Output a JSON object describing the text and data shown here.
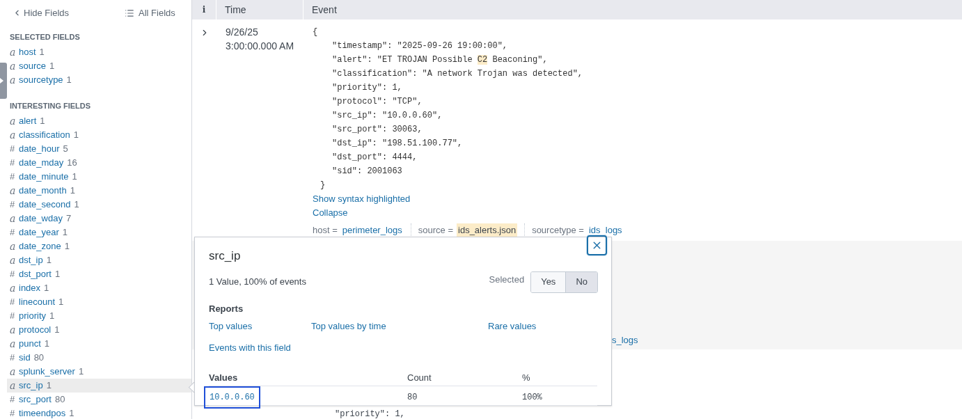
{
  "sidebar": {
    "hide_button": "Hide Fields",
    "all_fields_button": "All Fields",
    "groups": [
      {
        "title": "SELECTED FIELDS",
        "items": [
          {
            "kind": "string",
            "glyph": "a",
            "name": "host",
            "count": "1",
            "selected": false
          },
          {
            "kind": "string",
            "glyph": "a",
            "name": "source",
            "count": "1",
            "selected": false
          },
          {
            "kind": "string",
            "glyph": "a",
            "name": "sourcetype",
            "count": "1",
            "selected": false
          }
        ]
      },
      {
        "title": "INTERESTING FIELDS",
        "items": [
          {
            "kind": "string",
            "glyph": "a",
            "name": "alert",
            "count": "1",
            "selected": false
          },
          {
            "kind": "string",
            "glyph": "a",
            "name": "classification",
            "count": "1",
            "selected": false
          },
          {
            "kind": "number",
            "glyph": "#",
            "name": "date_hour",
            "count": "5",
            "selected": false
          },
          {
            "kind": "number",
            "glyph": "#",
            "name": "date_mday",
            "count": "16",
            "selected": false
          },
          {
            "kind": "number",
            "glyph": "#",
            "name": "date_minute",
            "count": "1",
            "selected": false
          },
          {
            "kind": "string",
            "glyph": "a",
            "name": "date_month",
            "count": "1",
            "selected": false
          },
          {
            "kind": "number",
            "glyph": "#",
            "name": "date_second",
            "count": "1",
            "selected": false
          },
          {
            "kind": "string",
            "glyph": "a",
            "name": "date_wday",
            "count": "7",
            "selected": false
          },
          {
            "kind": "number",
            "glyph": "#",
            "name": "date_year",
            "count": "1",
            "selected": false
          },
          {
            "kind": "string",
            "glyph": "a",
            "name": "date_zone",
            "count": "1",
            "selected": false
          },
          {
            "kind": "string",
            "glyph": "a",
            "name": "dst_ip",
            "count": "1",
            "selected": false
          },
          {
            "kind": "number",
            "glyph": "#",
            "name": "dst_port",
            "count": "1",
            "selected": false
          },
          {
            "kind": "string",
            "glyph": "a",
            "name": "index",
            "count": "1",
            "selected": false
          },
          {
            "kind": "number",
            "glyph": "#",
            "name": "linecount",
            "count": "1",
            "selected": false
          },
          {
            "kind": "number",
            "glyph": "#",
            "name": "priority",
            "count": "1",
            "selected": false
          },
          {
            "kind": "string",
            "glyph": "a",
            "name": "protocol",
            "count": "1",
            "selected": false
          },
          {
            "kind": "string",
            "glyph": "a",
            "name": "punct",
            "count": "1",
            "selected": false
          },
          {
            "kind": "number",
            "glyph": "#",
            "name": "sid",
            "count": "80",
            "selected": false
          },
          {
            "kind": "string",
            "glyph": "a",
            "name": "splunk_server",
            "count": "1",
            "selected": false
          },
          {
            "kind": "string",
            "glyph": "a",
            "name": "src_ip",
            "count": "1",
            "selected": true
          },
          {
            "kind": "number",
            "glyph": "#",
            "name": "src_port",
            "count": "80",
            "selected": false
          },
          {
            "kind": "number",
            "glyph": "#",
            "name": "timeendpos",
            "count": "1",
            "selected": false
          }
        ]
      }
    ]
  },
  "table": {
    "columns": [
      "i",
      "Time",
      "Event"
    ],
    "events": [
      {
        "date": "9/26/25",
        "time": "3:00:00.000 AM",
        "json": {
          "open": "{",
          "close": "}",
          "lines": [
            [
              {
                "text": "\"timestamp\": \"2025-09-26 19:00:00\",",
                "highlight": false
              }
            ],
            [
              {
                "text": "\"alert\": \"ET TROJAN Possible ",
                "highlight": false
              },
              {
                "text": "C2",
                "highlight": true
              },
              {
                "text": " Beaconing\",",
                "highlight": false
              }
            ],
            [
              {
                "text": "\"classification\": \"A network Trojan was detected\",",
                "highlight": false
              }
            ],
            [
              {
                "text": "\"priority\": 1,",
                "highlight": false
              }
            ],
            [
              {
                "text": "\"protocol\": \"TCP\",",
                "highlight": false
              }
            ],
            [
              {
                "text": "\"src_ip\": \"10.0.0.60\",",
                "highlight": false
              }
            ],
            [
              {
                "text": "\"src_port\": 30063,",
                "highlight": false
              }
            ],
            [
              {
                "text": "\"dst_ip\": \"198.51.100.77\",",
                "highlight": false
              }
            ],
            [
              {
                "text": "\"dst_port\": 4444,",
                "highlight": false
              }
            ],
            [
              {
                "text": "\"sid\": 2001063",
                "highlight": false
              }
            ]
          ]
        },
        "links": [
          "Show syntax highlighted",
          "Collapse"
        ],
        "fields": [
          {
            "key": "host =",
            "value": "perimeter_logs",
            "highlight": false
          },
          {
            "key": "source =",
            "value": "ids_alerts.json",
            "highlight": true
          },
          {
            "key": "sourcetype =",
            "value": "ids_logs",
            "highlight": false
          }
        ]
      }
    ],
    "partial_field_value": "s_logs",
    "partial_json_line": "\"priority\": 1,"
  },
  "popover": {
    "title": "src_ip",
    "summary": "1 Value, 100% of events",
    "selected_label": "Selected",
    "toggle": [
      {
        "label": "Yes",
        "selected": false
      },
      {
        "label": "No",
        "selected": true
      }
    ],
    "reports_title": "Reports",
    "reports": [
      "Top values",
      "Top values by time",
      "Rare values",
      "Events with this field"
    ],
    "values_columns": [
      "Values",
      "Count",
      "%"
    ],
    "values": [
      {
        "value": "10.0.0.60",
        "count": "80",
        "percent": "100%",
        "focused": true
      }
    ]
  }
}
